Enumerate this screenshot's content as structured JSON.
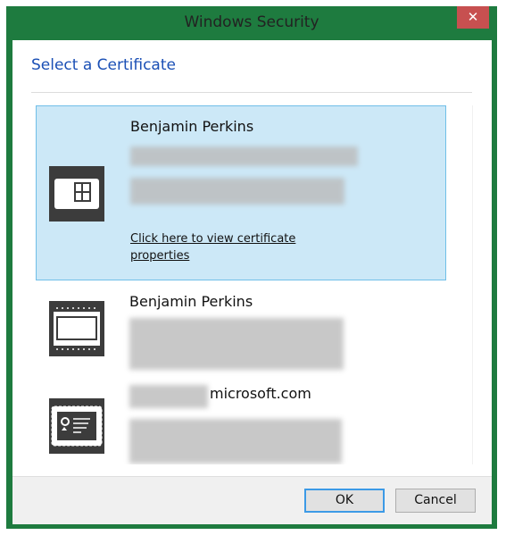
{
  "window": {
    "title": "Windows Security",
    "close_label": "✕"
  },
  "dialog": {
    "heading": "Select a Certificate"
  },
  "certificates": [
    {
      "name": "Benjamin Perkins",
      "selected": true,
      "icon": "smart-card-icon",
      "link": "Click here to view certificate properties"
    },
    {
      "name": "Benjamin Perkins",
      "selected": false,
      "icon": "chip-card-icon"
    },
    {
      "name": "microsoft.com",
      "selected": false,
      "icon": "certificate-icon"
    }
  ],
  "scrollbar": {
    "up_arrow": "˄"
  },
  "buttons": {
    "ok": "OK",
    "cancel": "Cancel"
  },
  "colors": {
    "frame": "#1e7b3f",
    "accent": "#1a4fb5",
    "selection": "#cce8f7",
    "close": "#c75050"
  }
}
